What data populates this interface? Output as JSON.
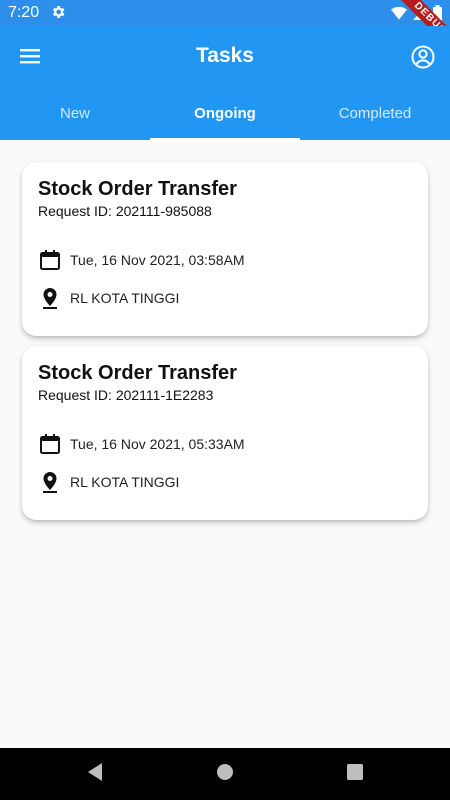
{
  "status_bar": {
    "time": "7:20",
    "debug_label": "DEBUG"
  },
  "app_bar": {
    "title": "Tasks"
  },
  "tabs": [
    {
      "label": "New",
      "active": false
    },
    {
      "label": "Ongoing",
      "active": true
    },
    {
      "label": "Completed",
      "active": false
    }
  ],
  "tasks": [
    {
      "title": "Stock Order Transfer",
      "request_id": "Request ID: 202111-985088",
      "date": "Tue, 16 Nov 2021, 03:58AM",
      "location": "RL KOTA TINGGI"
    },
    {
      "title": "Stock Order Transfer",
      "request_id": "Request ID: 202111-1E2283",
      "date": "Tue, 16 Nov 2021, 05:33AM",
      "location": "RL KOTA TINGGI"
    }
  ],
  "colors": {
    "primary": "#2196f3",
    "status_bar": "#2d8fe9",
    "background": "#fafafa"
  }
}
